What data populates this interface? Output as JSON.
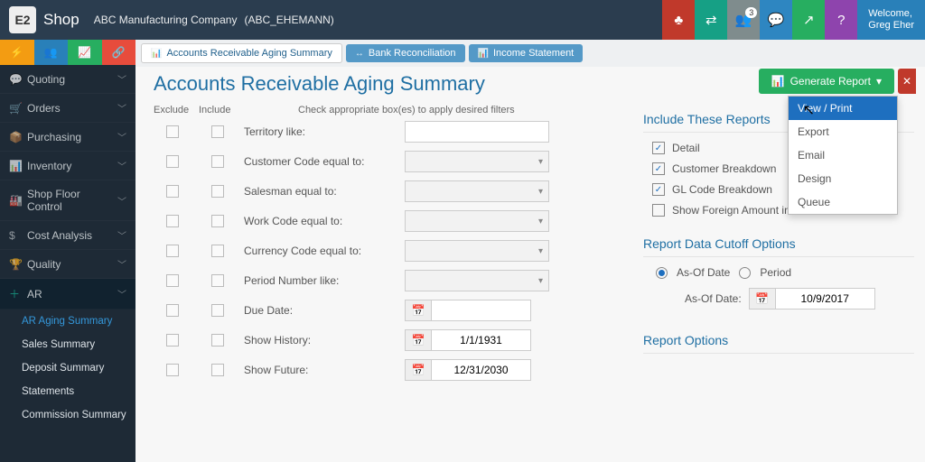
{
  "header": {
    "app_name": "Shop",
    "company": "ABC Manufacturing Company",
    "company_code": "(ABC_EHEMANN)",
    "badge": "3",
    "welcome": "Welcome,",
    "user": "Greg Eher"
  },
  "sidebar": {
    "items": [
      {
        "icon": "💬",
        "label": "Quoting"
      },
      {
        "icon": "🛒",
        "label": "Orders"
      },
      {
        "icon": "📦",
        "label": "Purchasing"
      },
      {
        "icon": "📊",
        "label": "Inventory"
      },
      {
        "icon": "🏭",
        "label": "Shop Floor Control"
      },
      {
        "icon": "$",
        "label": "Cost Analysis"
      },
      {
        "icon": "🏆",
        "label": "Quality"
      },
      {
        "icon": "＋",
        "label": "AR"
      }
    ],
    "subitems": [
      "AR Aging Summary",
      "Sales Summary",
      "Deposit Summary",
      "Statements",
      "Commission Summary"
    ]
  },
  "tabs": [
    {
      "icon": "📊",
      "label": "Accounts Receivable Aging Summary"
    },
    {
      "icon": "↔",
      "label": "Bank Reconciliation"
    },
    {
      "icon": "📊",
      "label": "Income Statement"
    }
  ],
  "page": {
    "title": "Accounts Receivable Aging Summary",
    "generate": "Generate Report",
    "dropdown": [
      "View / Print",
      "Export",
      "Email",
      "Design",
      "Queue"
    ]
  },
  "filters": {
    "col_exclude": "Exclude",
    "col_include": "Include",
    "hint": "Check appropriate box(es) to apply desired filters",
    "rows": [
      {
        "label": "Territory like:",
        "type": "text"
      },
      {
        "label": "Customer Code equal to:",
        "type": "drop"
      },
      {
        "label": "Salesman equal to:",
        "type": "drop"
      },
      {
        "label": "Work Code equal to:",
        "type": "drop"
      },
      {
        "label": "Currency Code equal to:",
        "type": "drop"
      },
      {
        "label": "Period Number like:",
        "type": "drop"
      },
      {
        "label": "Due Date:",
        "type": "date",
        "value": ""
      },
      {
        "label": "Show History:",
        "type": "date",
        "value": "1/1/1931"
      },
      {
        "label": "Show Future:",
        "type": "date",
        "value": "12/31/2030"
      }
    ]
  },
  "right": {
    "include_title": "Include These Reports",
    "reports": [
      {
        "label": "Detail",
        "on": true
      },
      {
        "label": "Customer Breakdown",
        "on": true
      },
      {
        "label": "GL Code Breakdown",
        "on": true
      },
      {
        "label": "Show Foreign Amount in Detail",
        "on": false
      }
    ],
    "cutoff_title": "Report Data Cutoff Options",
    "radio_asof": "As-Of Date",
    "radio_period": "Period",
    "asof_label": "As-Of Date:",
    "asof_value": "10/9/2017",
    "options_title": "Report Options"
  }
}
